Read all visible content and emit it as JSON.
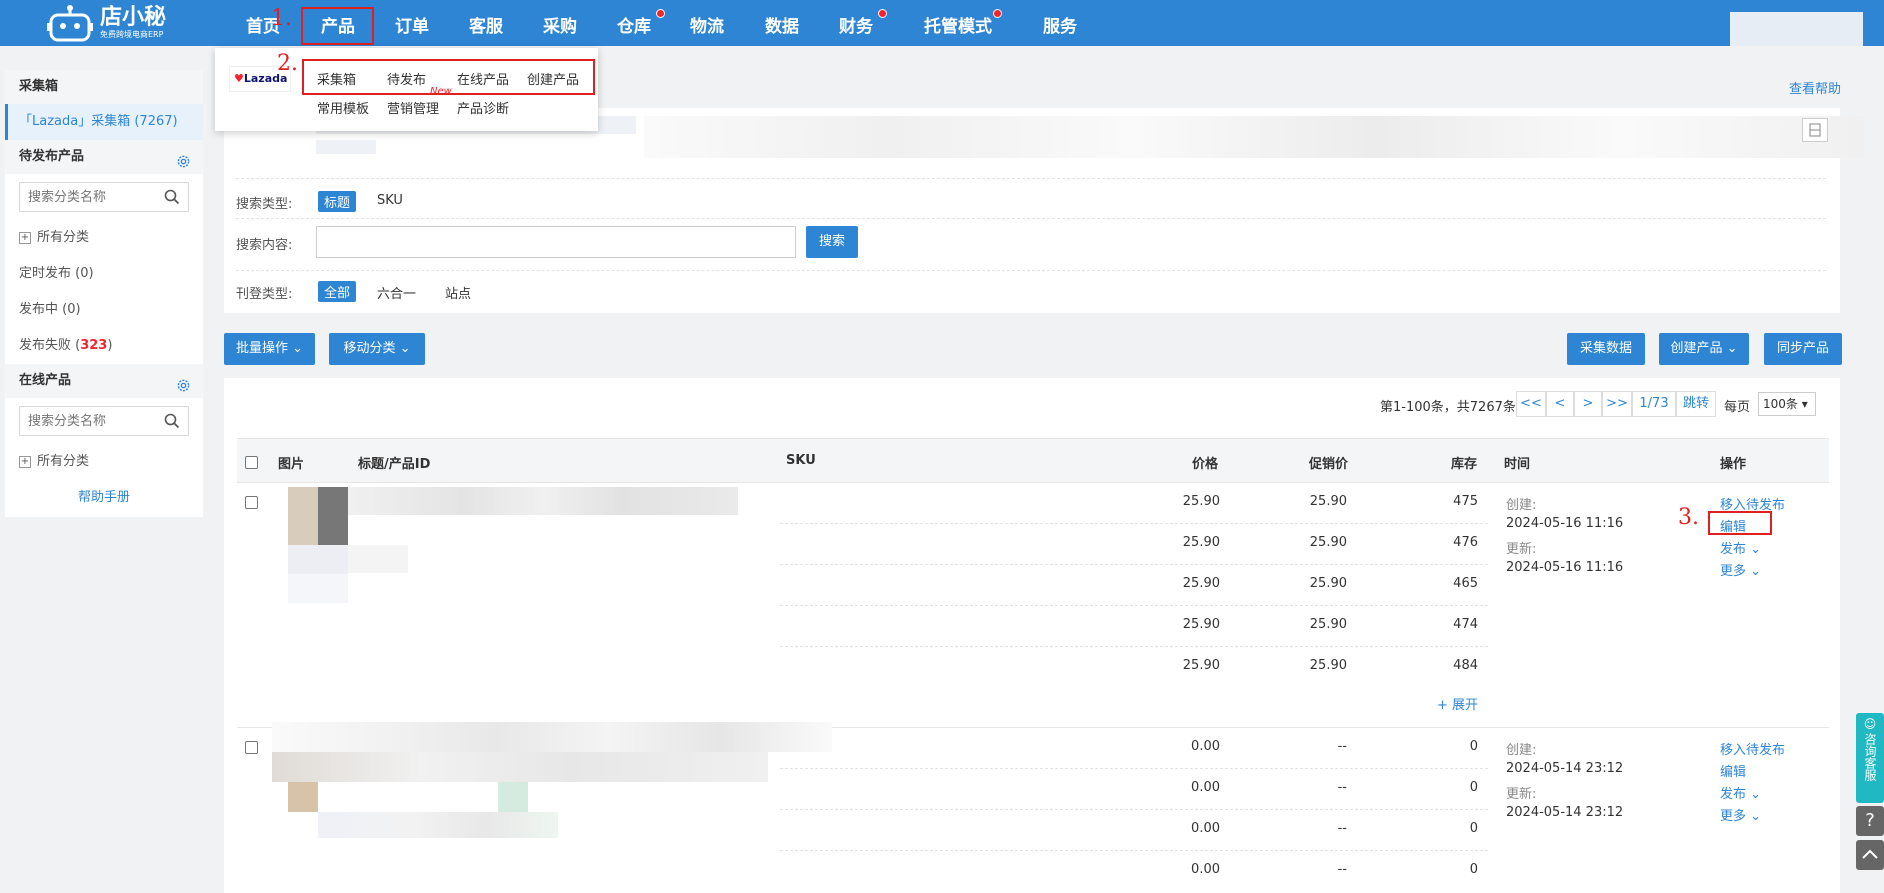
{
  "header": {
    "logo_main": "店小秘",
    "logo_sub": "免费跨境电商ERP",
    "nav": [
      {
        "label": "首页",
        "dot": false
      },
      {
        "label": "产品",
        "dot": false
      },
      {
        "label": "订单",
        "dot": false
      },
      {
        "label": "客服",
        "dot": false
      },
      {
        "label": "采购",
        "dot": false
      },
      {
        "label": "仓库",
        "dot": true
      },
      {
        "label": "物流",
        "dot": false
      },
      {
        "label": "数据",
        "dot": false
      },
      {
        "label": "财务",
        "dot": true
      },
      {
        "label": "托管模式",
        "dot": true
      },
      {
        "label": "服务",
        "dot": false
      }
    ]
  },
  "annotations": {
    "step1": "1.",
    "step2": "2.",
    "step3": "3."
  },
  "dropdown": {
    "platform": "Lazada",
    "row1": [
      "采集箱",
      "待发布",
      "在线产品",
      "创建产品"
    ],
    "row2": [
      "常用模板",
      "营销管理",
      "产品诊断"
    ],
    "new_badge": "New"
  },
  "sidebar": {
    "collect_title": "采集箱",
    "collect_item": "「Lazada」采集箱 (7267)",
    "pending_title": "待发布产品",
    "search_placeholder": "搜索分类名称",
    "all_categories": "所有分类",
    "scheduled": "定时发布 (0)",
    "publishing": "发布中 (0)",
    "failed_label": "发布失败 (",
    "failed_count": "323",
    "failed_close": ")",
    "online_title": "在线产品",
    "help": "帮助手册"
  },
  "help_link": "查看帮助",
  "filters": {
    "search_type_label": "搜索类型:",
    "search_types": [
      "标题",
      "SKU"
    ],
    "search_content_label": "搜索内容:",
    "search_button": "搜索",
    "listing_type_label": "刊登类型:",
    "listing_types": [
      "全部",
      "六合一",
      "站点"
    ]
  },
  "actions": {
    "batch": "批量操作",
    "move_category": "移动分类",
    "collect_data": "采集数据",
    "create_product": "创建产品",
    "sync_product": "同步产品"
  },
  "pager": {
    "summary": "第1-100条，共7267条",
    "first": "<<",
    "prev": "<",
    "next": ">",
    "last": ">>",
    "page": "1/73",
    "jump": "跳转",
    "per_page_label": "每页",
    "per_page": "100条"
  },
  "table": {
    "headers": [
      "图片",
      "标题/产品ID",
      "SKU",
      "价格",
      "促销价",
      "库存",
      "时间",
      "操作"
    ],
    "rows": [
      {
        "variants": [
          {
            "price": "25.90",
            "promo": "25.90",
            "stock": "475"
          },
          {
            "price": "25.90",
            "promo": "25.90",
            "stock": "476"
          },
          {
            "price": "25.90",
            "promo": "25.90",
            "stock": "465"
          },
          {
            "price": "25.90",
            "promo": "25.90",
            "stock": "474"
          },
          {
            "price": "25.90",
            "promo": "25.90",
            "stock": "484"
          }
        ],
        "expand": "+ 展开",
        "created_label": "创建:",
        "created": "2024-05-16 11:16",
        "updated_label": "更新:",
        "updated": "2024-05-16 11:16",
        "ops": [
          "移入待发布",
          "编辑",
          "发布",
          "更多"
        ]
      },
      {
        "variants": [
          {
            "price": "0.00",
            "promo": "--",
            "stock": "0"
          },
          {
            "price": "0.00",
            "promo": "--",
            "stock": "0"
          },
          {
            "price": "0.00",
            "promo": "--",
            "stock": "0"
          },
          {
            "price": "0.00",
            "promo": "--",
            "stock": "0"
          }
        ],
        "created_label": "创建:",
        "created": "2024-05-14 23:12",
        "updated_label": "更新:",
        "updated": "2024-05-14 23:12",
        "ops": [
          "移入待发布",
          "编辑",
          "发布",
          "更多"
        ]
      }
    ]
  },
  "float": {
    "consult": "咨询客服"
  },
  "colors": {
    "brand": "#2e85d4",
    "annotation": "#e02020",
    "danger": "#f5222d"
  }
}
